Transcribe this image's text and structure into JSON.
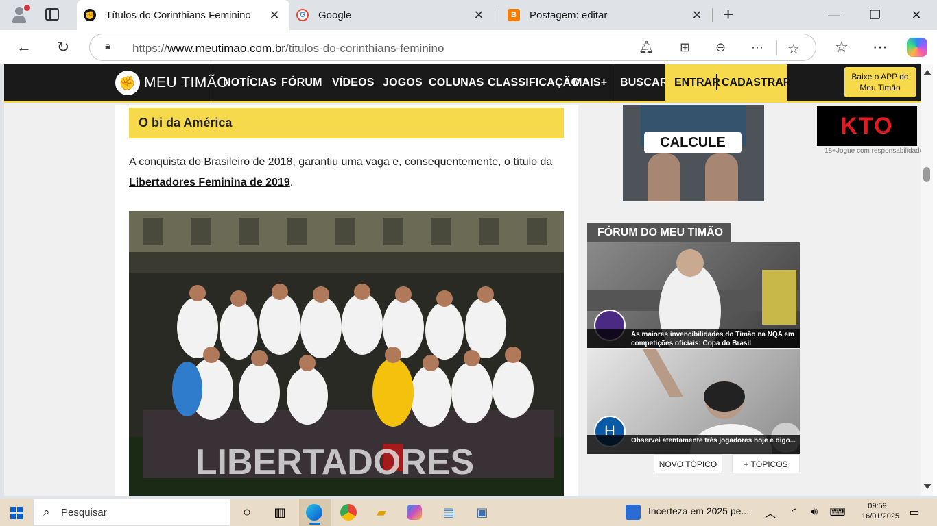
{
  "browser": {
    "tabs": [
      {
        "title": "Títulos do Corinthians Feminino",
        "active": true,
        "favicon": "meutimao-favicon-icon"
      },
      {
        "title": "Google",
        "active": false,
        "favicon": "google-favicon-icon"
      },
      {
        "title": "Postagem: editar",
        "active": false,
        "favicon": "blogger-favicon-icon"
      }
    ],
    "url_prefix": "https://",
    "url_domain": "www.meutimao.com.br",
    "url_path": "/titulos-do-corinthians-feminino"
  },
  "site": {
    "logo_text": "MEU TIMÃO",
    "nav": [
      "NOTÍCIAS",
      "FÓRUM",
      "VÍDEOS",
      "JOGOS",
      "COLUNAS",
      "CLASSIFICAÇÃO",
      "MAIS+",
      "BUSCAR"
    ],
    "entrar": "ENTRAR",
    "cadastrar": "CADASTRAR",
    "app_button": "Baixe o APP do Meu Timão",
    "accent_color": "#f7d94c"
  },
  "article": {
    "section_title": "O bi da América",
    "paragraph_text": "A conquista do Brasileiro de 2018, garantiu uma vaga e, consequentemente, o título da ",
    "paragraph_link": "Libertadores Feminina de 2019",
    "paragraph_end": ".",
    "photo_banner": "LIBERTADORES"
  },
  "ads": {
    "calcule": "CALCULE",
    "kto_logo": "KTO",
    "kto_note": "18+Jogue com responsabilidade"
  },
  "forum": {
    "title": "FÓRUM DO MEU TIMÃO",
    "posts": [
      {
        "caption": "As maiores invencibilidades do Timão na NQA em competições oficiais: Copa do Brasil",
        "avatar_letter": ""
      },
      {
        "caption": "Observei atentamente três jogadores hoje e digo...",
        "avatar_letter": "H"
      }
    ],
    "new_topic": "NOVO TÓPICO",
    "more_topics": "+ TÓPICOS"
  },
  "taskbar": {
    "search_placeholder": "Pesquisar",
    "weather": "Incerteza em 2025 pe...",
    "time": "09:59",
    "date": "16/01/2025"
  }
}
